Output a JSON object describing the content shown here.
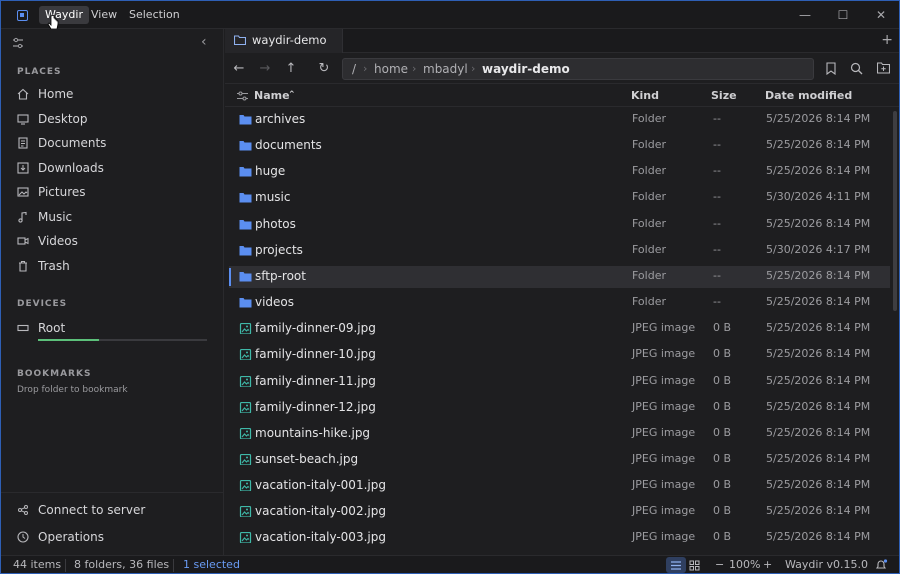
{
  "menu": {
    "items": [
      "Waydir",
      "View",
      "Selection"
    ]
  },
  "sidebar": {
    "places_title": "PLACES",
    "places": [
      {
        "label": "Home",
        "icon": "home-icon"
      },
      {
        "label": "Desktop",
        "icon": "desktop-icon"
      },
      {
        "label": "Documents",
        "icon": "documents-icon"
      },
      {
        "label": "Downloads",
        "icon": "downloads-icon"
      },
      {
        "label": "Pictures",
        "icon": "pictures-icon"
      },
      {
        "label": "Music",
        "icon": "music-icon"
      },
      {
        "label": "Videos",
        "icon": "videos-icon"
      },
      {
        "label": "Trash",
        "icon": "trash-icon"
      }
    ],
    "devices_title": "DEVICES",
    "devices": [
      {
        "label": "Root",
        "icon": "drive-icon",
        "usage": 0.36,
        "usage_color": "#5cc07a"
      }
    ],
    "bookmarks_title": "BOOKMARKS",
    "bookmarks_hint": "Drop folder to bookmark",
    "connect_label": "Connect to server",
    "operations_label": "Operations"
  },
  "tab": {
    "label": "waydir-demo"
  },
  "path": {
    "root": "/",
    "segments": [
      "home",
      "mbadyl",
      "waydir-demo"
    ]
  },
  "columns": {
    "name": "Name",
    "kind": "Kind",
    "size": "Size",
    "date": "Date modified"
  },
  "files": [
    {
      "name": "archives",
      "kind": "Folder",
      "size": "--",
      "date": "5/25/2026 8:14 PM",
      "type": "folder"
    },
    {
      "name": "documents",
      "kind": "Folder",
      "size": "--",
      "date": "5/25/2026 8:14 PM",
      "type": "folder"
    },
    {
      "name": "huge",
      "kind": "Folder",
      "size": "--",
      "date": "5/25/2026 8:14 PM",
      "type": "folder"
    },
    {
      "name": "music",
      "kind": "Folder",
      "size": "--",
      "date": "5/30/2026 4:11 PM",
      "type": "folder"
    },
    {
      "name": "photos",
      "kind": "Folder",
      "size": "--",
      "date": "5/25/2026 8:14 PM",
      "type": "folder"
    },
    {
      "name": "projects",
      "kind": "Folder",
      "size": "--",
      "date": "5/30/2026 4:17 PM",
      "type": "folder"
    },
    {
      "name": "sftp-root",
      "kind": "Folder",
      "size": "--",
      "date": "5/25/2026 8:14 PM",
      "type": "folder",
      "selected": true
    },
    {
      "name": "videos",
      "kind": "Folder",
      "size": "--",
      "date": "5/25/2026 8:14 PM",
      "type": "folder"
    },
    {
      "name": "family-dinner-09.jpg",
      "kind": "JPEG image",
      "size": "0 B",
      "date": "5/25/2026 8:14 PM",
      "type": "image"
    },
    {
      "name": "family-dinner-10.jpg",
      "kind": "JPEG image",
      "size": "0 B",
      "date": "5/25/2026 8:14 PM",
      "type": "image"
    },
    {
      "name": "family-dinner-11.jpg",
      "kind": "JPEG image",
      "size": "0 B",
      "date": "5/25/2026 8:14 PM",
      "type": "image"
    },
    {
      "name": "family-dinner-12.jpg",
      "kind": "JPEG image",
      "size": "0 B",
      "date": "5/25/2026 8:14 PM",
      "type": "image"
    },
    {
      "name": "mountains-hike.jpg",
      "kind": "JPEG image",
      "size": "0 B",
      "date": "5/25/2026 8:14 PM",
      "type": "image"
    },
    {
      "name": "sunset-beach.jpg",
      "kind": "JPEG image",
      "size": "0 B",
      "date": "5/25/2026 8:14 PM",
      "type": "image"
    },
    {
      "name": "vacation-italy-001.jpg",
      "kind": "JPEG image",
      "size": "0 B",
      "date": "5/25/2026 8:14 PM",
      "type": "image"
    },
    {
      "name": "vacation-italy-002.jpg",
      "kind": "JPEG image",
      "size": "0 B",
      "date": "5/25/2026 8:14 PM",
      "type": "image"
    },
    {
      "name": "vacation-italy-003.jpg",
      "kind": "JPEG image",
      "size": "0 B",
      "date": "5/25/2026 8:14 PM",
      "type": "image"
    }
  ],
  "status": {
    "items": "44 items",
    "summary": "8 folders, 36 files",
    "selected": "1 selected",
    "zoom": "100%",
    "zoom_minus": "−",
    "zoom_plus": "+",
    "version": "Waydir v0.15.0"
  },
  "colors": {
    "accent": "#5b8ef0",
    "folder": "#5b8ef0",
    "image": "#3fb8a8",
    "usage": "#5cc07a"
  }
}
